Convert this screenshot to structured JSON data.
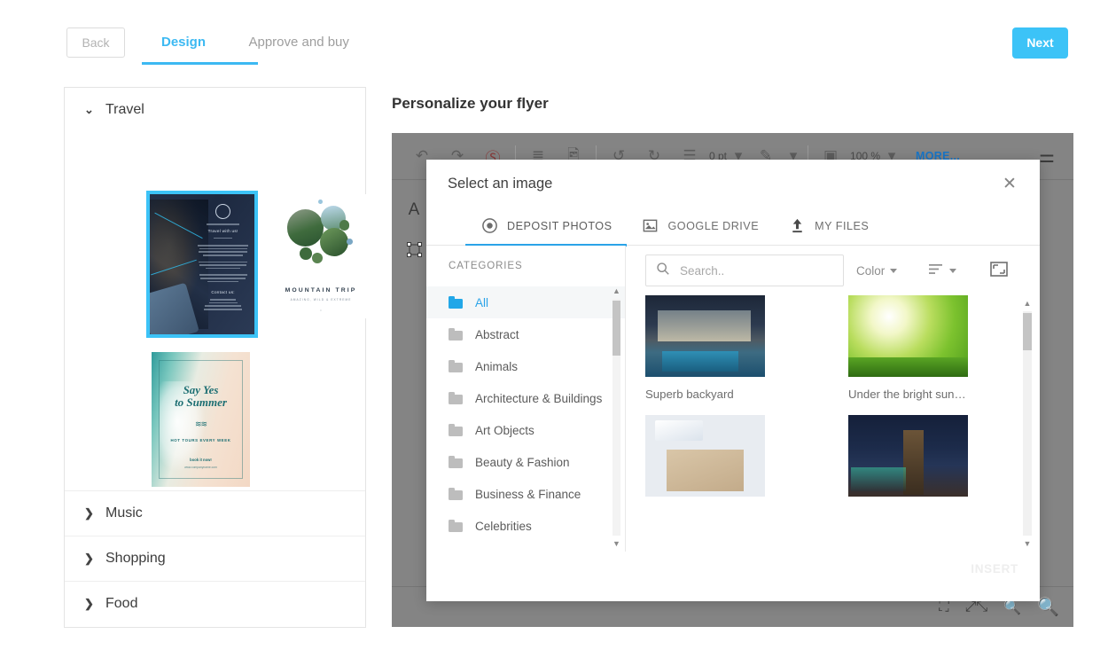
{
  "topbar": {
    "back_label": "Back",
    "next_label": "Next",
    "steps": [
      {
        "label": "Design",
        "active": true
      },
      {
        "label": "Approve and buy",
        "active": false
      }
    ]
  },
  "page": {
    "heading": "Personalize your flyer"
  },
  "sidebar": {
    "sections": [
      {
        "label": "Travel",
        "expanded": true,
        "chevron": "chevron-down"
      },
      {
        "label": "Music",
        "expanded": false,
        "chevron": "chevron-right"
      },
      {
        "label": "Shopping",
        "expanded": false,
        "chevron": "chevron-right"
      },
      {
        "label": "Food",
        "expanded": false,
        "chevron": "chevron-right"
      }
    ],
    "templates": [
      {
        "name": "travel-with-us-flyer",
        "selected": true,
        "headline": "Travel with us!",
        "contact": "Contact us:"
      },
      {
        "name": "mountain-trip-flyer",
        "selected": false,
        "title": "MOUNTAIN TRIP",
        "subtitle": "AMAZING, WILD & EXTREME",
        "dot": "•"
      },
      {
        "name": "say-yes-to-summer-flyer",
        "selected": false,
        "title_line1": "Say Yes",
        "title_line2": "to Summer",
        "wave": "≋≋",
        "tagline": "HOT TOURS EVERY WEEK",
        "cta": "book it now!",
        "url": "www.companyname.com"
      }
    ]
  },
  "editor": {
    "toolbar": {
      "undo_icon": "undo-icon",
      "redo_icon": "redo-icon",
      "clear_icon": "clear-format-icon",
      "adjust_icon": "adjustments-icon",
      "image_icon": "image-icon",
      "rotate_left_icon": "rotate-left-icon",
      "rotate_right_icon": "rotate-right-icon",
      "lines_icon": "line-weight-icon",
      "line_size": "0 pt",
      "pen_icon": "pen-icon",
      "crop_icon": "crop-icon",
      "zoom_value": "100 %",
      "more_label": "MORE...",
      "layers_icon": "layers-icon"
    },
    "left_tools": [
      {
        "icon": "text-tool-icon",
        "glyph": "A"
      },
      {
        "icon": "shape-transform-icon",
        "glyph": "⬚"
      }
    ],
    "bottom": {
      "fit_icon": "fit-to-screen-icon",
      "collapse_icon": "collapse-icon",
      "zoom_out_icon": "zoom-out-icon",
      "zoom_in_icon": "zoom-in-icon"
    }
  },
  "modal": {
    "title": "Select an image",
    "close_icon": "close-icon",
    "tabs": [
      {
        "label": "DEPOSIT PHOTOS",
        "icon": "deposit-photos-icon",
        "active": true
      },
      {
        "label": "GOOGLE DRIVE",
        "icon": "google-drive-image-icon",
        "active": false
      },
      {
        "label": "MY FILES",
        "icon": "upload-icon",
        "active": false
      }
    ],
    "categories_title": "CATEGORIES",
    "categories": [
      {
        "label": "All",
        "active": true
      },
      {
        "label": "Abstract",
        "active": false
      },
      {
        "label": "Animals",
        "active": false
      },
      {
        "label": "Architecture & Buildings",
        "active": false
      },
      {
        "label": "Art Objects",
        "active": false
      },
      {
        "label": "Beauty & Fashion",
        "active": false
      },
      {
        "label": "Business & Finance",
        "active": false
      },
      {
        "label": "Celebrities",
        "active": false
      }
    ],
    "search": {
      "placeholder": "Search..",
      "value": "",
      "icon": "search-icon"
    },
    "controls": {
      "color_label": "Color",
      "sort_icon": "sort-icon",
      "size_icon": "image-size-icon"
    },
    "results": [
      {
        "caption": "Superb backyard",
        "thumb": "modern-house-pool-photo"
      },
      {
        "caption": "Under the bright sun…",
        "thumb": "sunlit-green-grass-photo"
      },
      {
        "caption": "",
        "thumb": "desk-flatlay-photo"
      },
      {
        "caption": "",
        "thumb": "city-skyline-night-photo"
      }
    ],
    "insert_label": "INSERT",
    "insert_enabled": false
  },
  "colors": {
    "accent": "#3cc3f7",
    "tab_active": "#2aa3e8",
    "more_link": "#1976c8",
    "canvas": "#848484"
  }
}
